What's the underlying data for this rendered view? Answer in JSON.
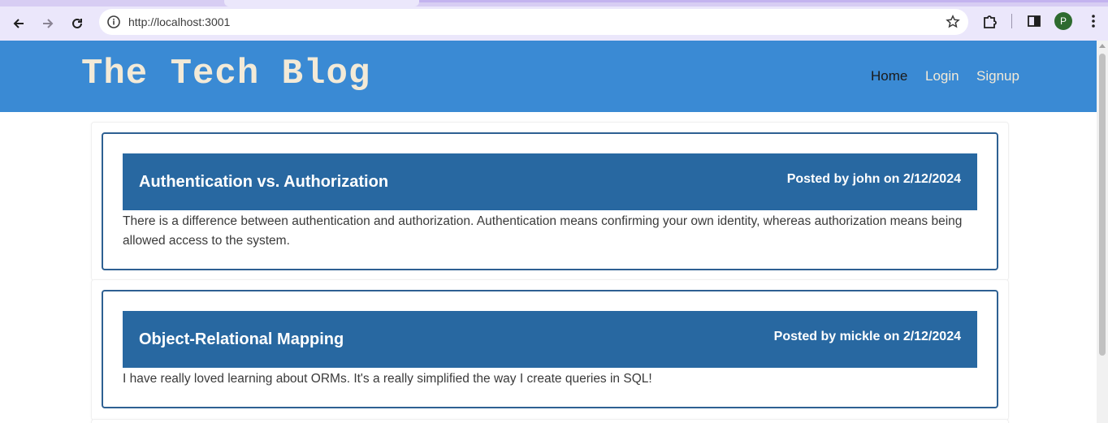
{
  "browser": {
    "url": "http://localhost:3001",
    "profile_initial": "P",
    "icons": {
      "back": "arrow-left-icon",
      "forward": "arrow-right-icon",
      "reload": "reload-icon",
      "site_info": "info-icon",
      "bookmark": "star-icon",
      "extensions": "puzzle-icon",
      "side_panel": "side-panel-icon",
      "menu": "kebab-menu-icon"
    }
  },
  "site": {
    "title": "The Tech Blog",
    "nav": {
      "home": "Home",
      "login": "Login",
      "signup": "Signup"
    },
    "colors": {
      "header": "#3a8ad4",
      "post_header": "#2868a1",
      "card_border": "#2e6092",
      "title_text": "#f3ead7"
    }
  },
  "posts": [
    {
      "title": "Authentication vs. Authorization",
      "meta": "Posted by john on 2/12/2024",
      "body": "There is a difference between authentication and authorization. Authentication means confirming your own identity, whereas authorization means being allowed access to the system."
    },
    {
      "title": "Object-Relational Mapping",
      "meta": "Posted by mickle on 2/12/2024",
      "body": "I have really loved learning about ORMs. It's a really simplified the way I create queries in SQL!"
    }
  ]
}
